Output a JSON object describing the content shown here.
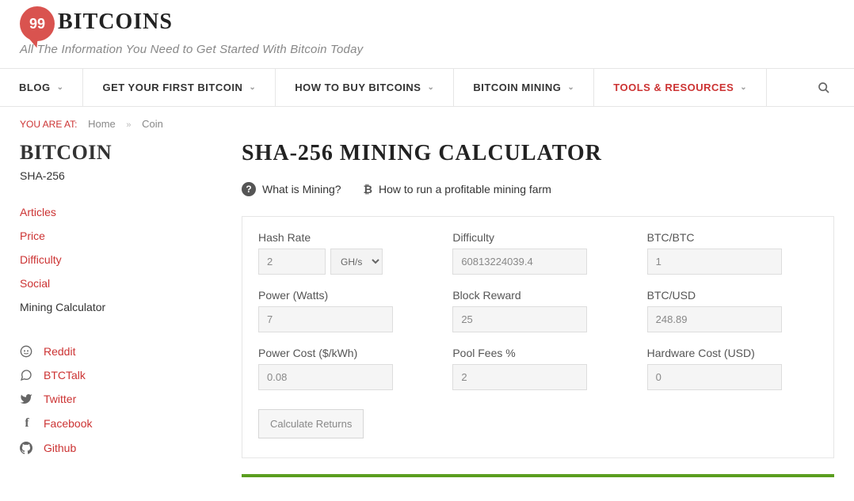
{
  "header": {
    "logo_num": "99",
    "logo_text": "BITCOINS",
    "tagline": "All The Information You Need to Get Started With Bitcoin Today"
  },
  "nav": {
    "items": [
      {
        "label": "BLOG"
      },
      {
        "label": "GET YOUR FIRST BITCOIN"
      },
      {
        "label": "HOW TO BUY BITCOINS"
      },
      {
        "label": "BITCOIN MINING"
      },
      {
        "label": "TOOLS & RESOURCES",
        "active": true
      }
    ]
  },
  "breadcrumb": {
    "label": "YOU ARE AT:",
    "home": "Home",
    "sep": "»",
    "current": "Coin"
  },
  "sidebar": {
    "title": "BITCOIN",
    "subtitle": "SHA-256",
    "links": [
      {
        "label": "Articles"
      },
      {
        "label": "Price"
      },
      {
        "label": "Difficulty"
      },
      {
        "label": "Social"
      },
      {
        "label": "Mining Calculator",
        "current": true
      }
    ],
    "socials": [
      {
        "label": "Reddit",
        "icon": "reddit"
      },
      {
        "label": "BTCTalk",
        "icon": "chat"
      },
      {
        "label": "Twitter",
        "icon": "twitter"
      },
      {
        "label": "Facebook",
        "icon": "facebook"
      },
      {
        "label": "Github",
        "icon": "github"
      }
    ]
  },
  "main": {
    "title": "SHA-256 MINING CALCULATOR",
    "info_links": {
      "mining": "What is Mining?",
      "profitable": "How to run a profitable mining farm"
    },
    "fields": {
      "hash_rate": {
        "label": "Hash Rate",
        "value": "2",
        "unit": "GH/s"
      },
      "difficulty": {
        "label": "Difficulty",
        "value": "60813224039.4"
      },
      "btc_btc": {
        "label": "BTC/BTC",
        "value": "1"
      },
      "power": {
        "label": "Power (Watts)",
        "value": "7"
      },
      "reward": {
        "label": "Block Reward",
        "value": "25"
      },
      "btc_usd": {
        "label": "BTC/USD",
        "value": "248.89"
      },
      "power_cost": {
        "label": "Power Cost ($/kWh)",
        "value": "0.08"
      },
      "pool": {
        "label": "Pool Fees %",
        "value": "2"
      },
      "hardware": {
        "label": "Hardware Cost (USD)",
        "value": "0"
      }
    },
    "calc_button": "Calculate Returns"
  }
}
